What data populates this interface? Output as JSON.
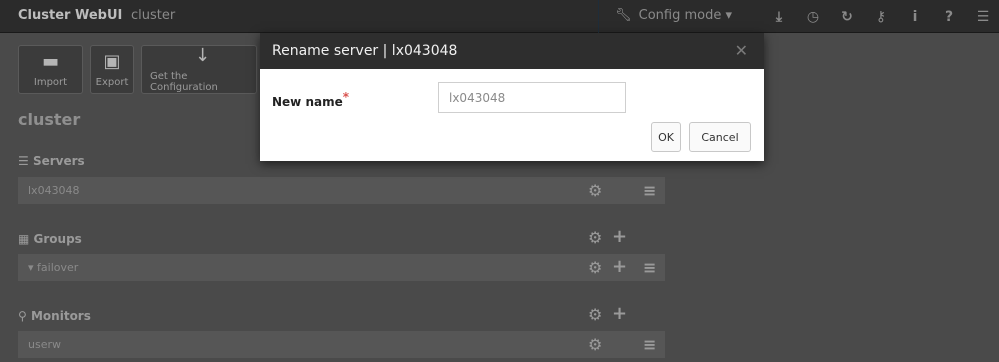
{
  "topbar": {
    "app_title": "Cluster WebUI",
    "cluster_name": "cluster",
    "mode_label": "Config mode",
    "mode_caret": "▾",
    "icons": [
      "download-icon",
      "clock-icon",
      "refresh-icon",
      "key-icon",
      "info-icon",
      "help-icon",
      "menu-icon"
    ]
  },
  "toolbar": {
    "import_label": "Import",
    "export_label": "Export",
    "get_config_label": "Get the Configuration"
  },
  "cluster_title": "cluster",
  "servers": {
    "heading": "Servers",
    "items": [
      "lx043048"
    ]
  },
  "groups": {
    "heading": "Groups",
    "items": [
      "failover"
    ]
  },
  "monitors": {
    "heading": "Monitors",
    "items": [
      "userw"
    ]
  },
  "modal": {
    "title": "Rename server | lx043048",
    "field_label": "New name",
    "required_mark": "*",
    "field_value": "lx043048",
    "ok_label": "OK",
    "cancel_label": "Cancel"
  },
  "colors": {
    "background": "#4a4a4a",
    "topbar": "#2b2b2b",
    "modal_header": "#2e2e2e",
    "required": "#d9534f"
  }
}
